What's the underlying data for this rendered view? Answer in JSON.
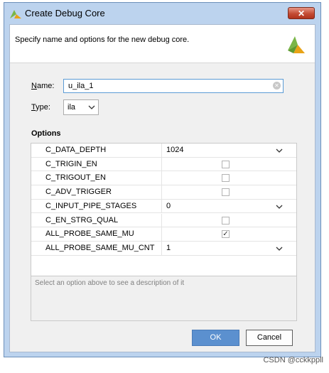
{
  "window": {
    "title": "Create Debug Core",
    "close_glyph": "✕"
  },
  "header": {
    "description": "Specify name and options for the new debug core."
  },
  "form": {
    "name_label_mnemonic": "N",
    "name_label_rest": "ame:",
    "name_value": "u_ila_1",
    "type_label_mnemonic": "T",
    "type_label_rest": "ype:",
    "type_value": "ila"
  },
  "options": {
    "heading": "Options",
    "rows": [
      {
        "name": "C_DATA_DEPTH",
        "kind": "select",
        "value": "1024"
      },
      {
        "name": "C_TRIGIN_EN",
        "kind": "checkbox",
        "checked": false
      },
      {
        "name": "C_TRIGOUT_EN",
        "kind": "checkbox",
        "checked": false
      },
      {
        "name": "C_ADV_TRIGGER",
        "kind": "checkbox",
        "checked": false
      },
      {
        "name": "C_INPUT_PIPE_STAGES",
        "kind": "select",
        "value": "0"
      },
      {
        "name": "C_EN_STRG_QUAL",
        "kind": "checkbox",
        "checked": false
      },
      {
        "name": "ALL_PROBE_SAME_MU",
        "kind": "checkbox",
        "checked": true
      },
      {
        "name": "ALL_PROBE_SAME_MU_CNT",
        "kind": "select",
        "value": "1"
      }
    ],
    "description_hint": "Select an option above to see a description of it"
  },
  "buttons": {
    "ok": "OK",
    "cancel": "Cancel"
  },
  "watermark": "CSDN @cckkppll",
  "icons": {
    "title": "vivado-logo-icon",
    "header": "vivado-logo-icon",
    "clear": "clear-icon",
    "dropdown": "chevron-down-icon",
    "check": "checkmark-icon"
  },
  "colors": {
    "title_bar": "#bcd3ee",
    "ok_button": "#5b90cf",
    "close_button": "#c44c34",
    "logo_green": "#7ab648",
    "logo_yellow": "#e8a317"
  }
}
